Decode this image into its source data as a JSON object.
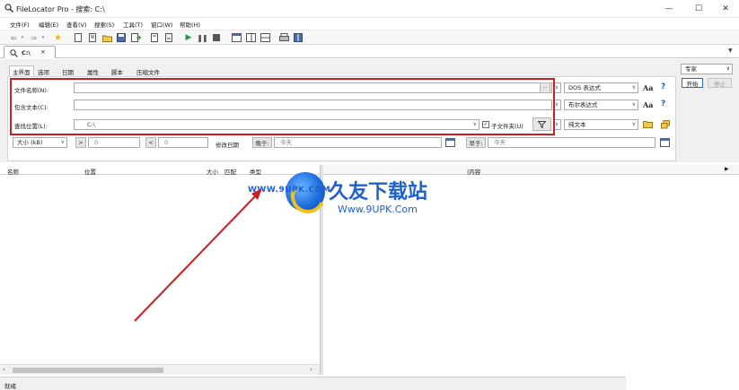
{
  "window": {
    "title": "FileLocator Pro - 搜索: C:\\",
    "minimize": "—",
    "maximize": "☐",
    "close": "✕"
  },
  "menu": [
    "文件(F)",
    "编辑(E)",
    "查看(V)",
    "搜索(S)",
    "工具(T)",
    "窗口(W)",
    "帮助(H)"
  ],
  "doc_tab": {
    "label": "C:\\",
    "close": "×"
  },
  "panel_tabs": [
    "主界面",
    "选项",
    "日期",
    "属性",
    "脚本",
    "压缩文件"
  ],
  "search": {
    "filename_label": "文件名称(N):",
    "filename_value": "",
    "filename_mode": "DOS 表达式",
    "content_label": "包含文本(C):",
    "content_value": "",
    "content_mode": "布尔表达式",
    "location_label": "查找位置(L):",
    "location_value": "C:\\",
    "subfolders_label": "子文件夹(U)",
    "subfolders_checked": true,
    "location_mode": "纯文本"
  },
  "size_filter": {
    "unit": "大小 (kB)",
    "gt_symbol": ">",
    "gt_value": "0",
    "lt_symbol": "<",
    "lt_value": "0"
  },
  "date_filter": {
    "label": "修改日期",
    "after_label": "晚于:",
    "after_value": "今天",
    "before_label": "早于:",
    "before_value": "今天"
  },
  "right_panel": {
    "mode": "专家",
    "start_button": "开始",
    "stop_button": "停止"
  },
  "results_columns": [
    "名称",
    "位置",
    "大小",
    "匹配",
    "类型"
  ],
  "preview_tab_last": "|内容",
  "status": "就绪",
  "watermark": {
    "brand": "久友下载站",
    "url": "Www.9UPK.Com",
    "small": "WWW.9UPK.COM"
  },
  "accent": {
    "annotation_red": "#c91e23",
    "help_blue": "#1f5fb8"
  }
}
